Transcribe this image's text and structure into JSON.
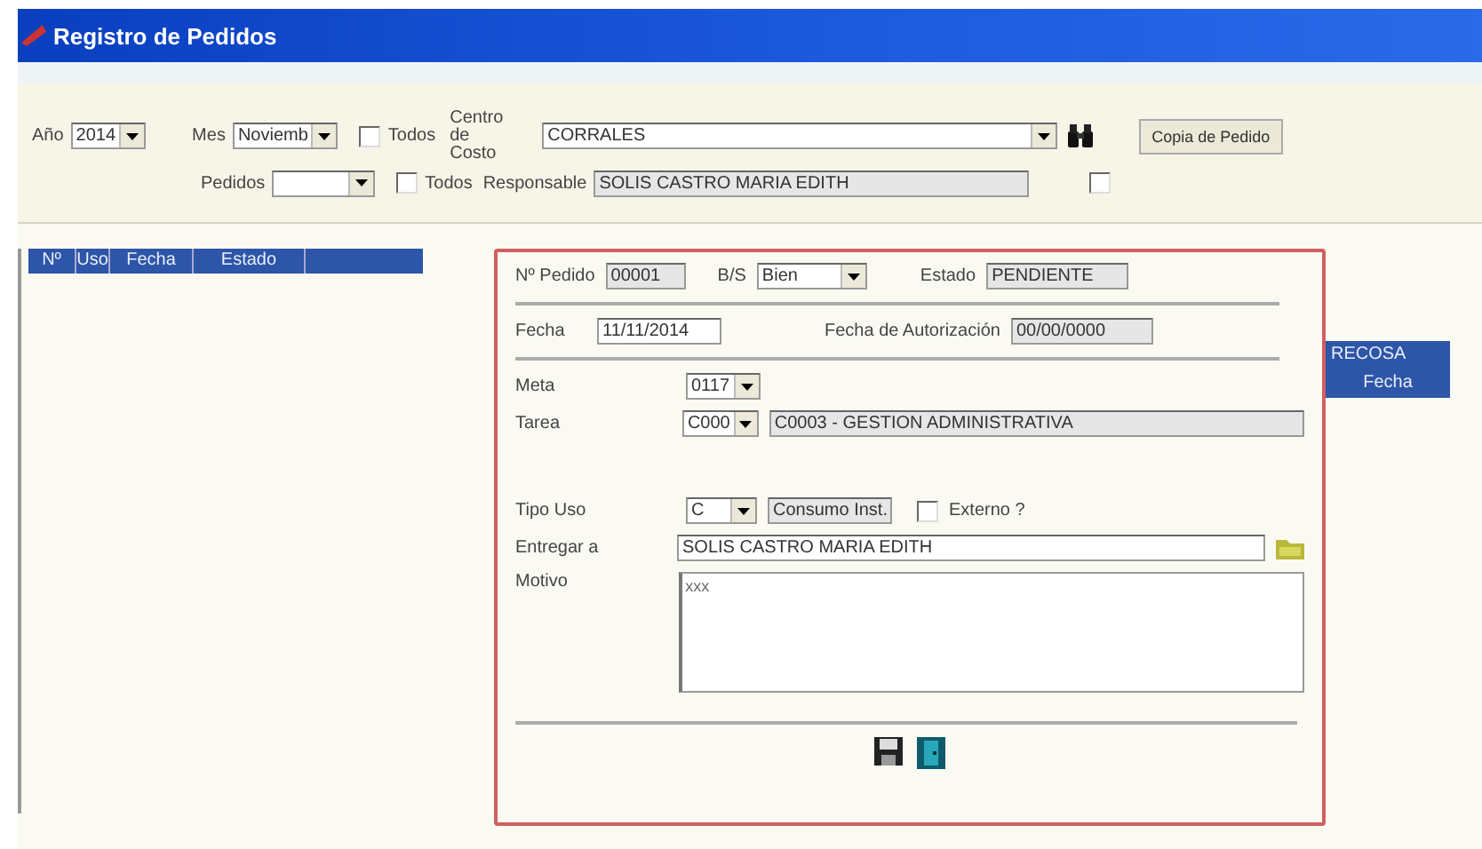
{
  "window": {
    "title": "Registro de Pedidos"
  },
  "filters": {
    "year": {
      "label": "Año",
      "value": "2014"
    },
    "month": {
      "label": "Mes",
      "value": "Noviemb"
    },
    "month_all": {
      "label": "Todos",
      "checked": false
    },
    "orders": {
      "label": "Pedidos"
    },
    "orders_all": {
      "label": "Todos",
      "checked": false
    },
    "cost_center": {
      "label": "Centro de Costo",
      "value": "CORRALES"
    },
    "responsible": {
      "label": "Responsable",
      "value": "SOLIS CASTRO MARIA EDITH",
      "checked": false
    },
    "copy_button": "Copia de Pedido"
  },
  "list": {
    "columns": [
      "Nº",
      "Uso",
      "Fecha",
      "Estado"
    ]
  },
  "form": {
    "order_no": {
      "label": "Nº Pedido",
      "value": "00001"
    },
    "bs": {
      "label": "B/S",
      "value": "Bien"
    },
    "status": {
      "label": "Estado",
      "value": "PENDIENTE"
    },
    "date": {
      "label": "Fecha",
      "value": "11/11/2014"
    },
    "auth_date": {
      "label": "Fecha de Autorización",
      "value": "00/00/0000"
    },
    "goal": {
      "label": "Meta",
      "value": "0117"
    },
    "task": {
      "label": "Tarea",
      "code": "C000",
      "value": "C0003 - GESTION ADMINISTRATIVA"
    },
    "use_type": {
      "label": "Tipo Uso",
      "code": "C",
      "value": "Consumo Inst."
    },
    "external": {
      "label": "Externo ?",
      "checked": false
    },
    "deliver_to": {
      "label": "Entregar a",
      "value": "SOLIS CASTRO MARIA EDITH"
    },
    "reason": {
      "label": "Motivo",
      "value": "xxx"
    }
  },
  "side_table": {
    "columns": [
      "RECOSA",
      "Fecha"
    ]
  }
}
